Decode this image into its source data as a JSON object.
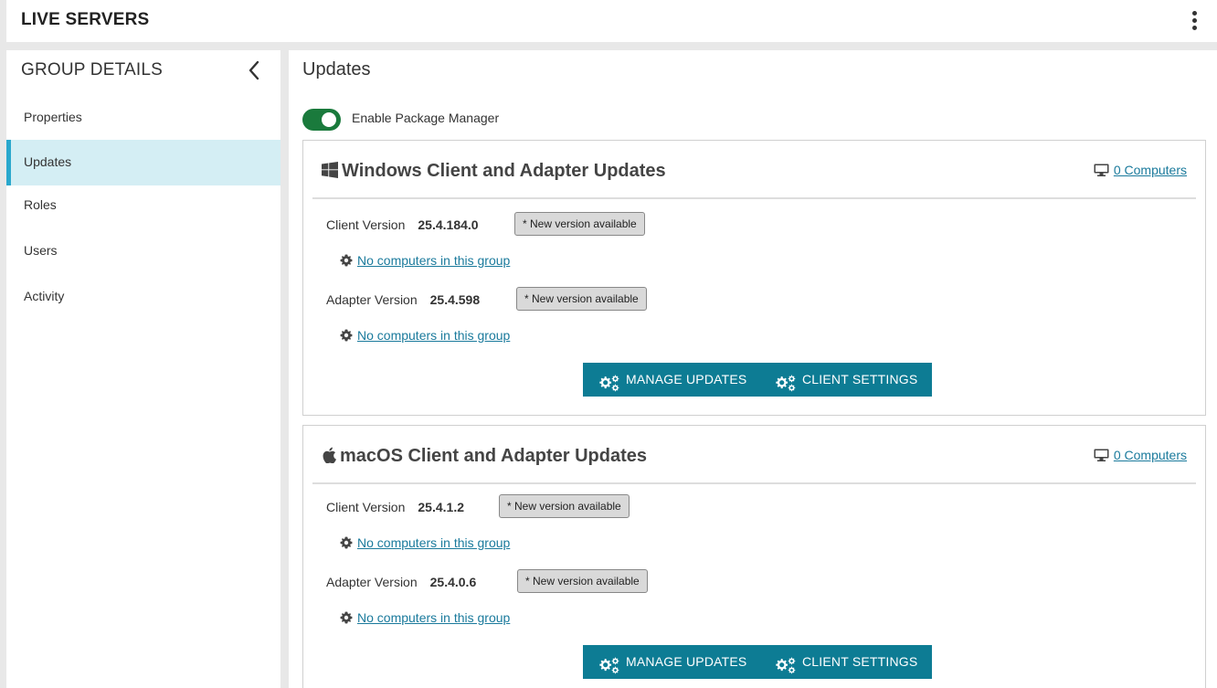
{
  "header": {
    "title": "LIVE SERVERS",
    "menu_icon": "kebab-vertical-icon"
  },
  "sidebar": {
    "heading": "GROUP DETAILS",
    "collapse_icon": "chevron-left-icon",
    "items": [
      {
        "label": "Properties",
        "active": false
      },
      {
        "label": "Updates",
        "active": true
      },
      {
        "label": "Roles",
        "active": false
      },
      {
        "label": "Users",
        "active": false
      },
      {
        "label": "Activity",
        "active": false
      }
    ]
  },
  "main": {
    "title": "Updates",
    "package_manager": {
      "label": "Enable Package Manager",
      "enabled": true
    },
    "sections": [
      {
        "title": "Windows Client and Adapter Updates",
        "os_icon": "windows-logo-icon",
        "computers_link": "0 Computers",
        "client": {
          "label": "Client Version",
          "version": "25.4.184.0",
          "badge": "* New version available",
          "status_link": "No computers in this group"
        },
        "adapter": {
          "label": "Adapter Version",
          "version": "25.4.598",
          "badge": "* New version available",
          "status_link": "No computers in this group"
        },
        "buttons": {
          "manage": "MANAGE UPDATES",
          "settings": "CLIENT SETTINGS"
        }
      },
      {
        "title": "macOS Client and Adapter Updates",
        "os_icon": "apple-logo-icon",
        "computers_link": "0 Computers",
        "client": {
          "label": "Client Version",
          "version": "25.4.1.2",
          "badge": "* New version available",
          "status_link": "No computers in this group"
        },
        "adapter": {
          "label": "Adapter Version",
          "version": "25.4.0.6",
          "badge": "* New version available",
          "status_link": "No computers in this group"
        },
        "buttons": {
          "manage": "MANAGE UPDATES",
          "settings": "CLIENT SETTINGS"
        }
      }
    ]
  },
  "colors": {
    "primary_button": "#0d7c94",
    "link": "#1a7a9c",
    "toggle_on": "#1a7a3c",
    "active_nav_bg": "#d4eef4",
    "active_nav_accent": "#2aa8cd",
    "badge_bg": "#d9d9d9"
  }
}
